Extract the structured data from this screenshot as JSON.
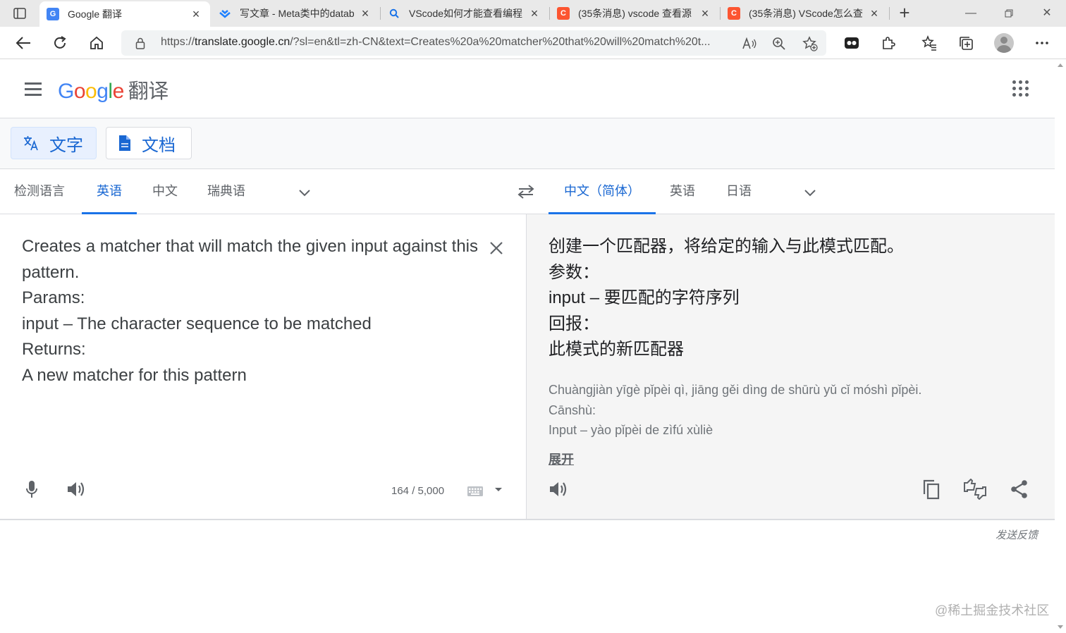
{
  "browser": {
    "tabs": [
      {
        "title": "Google 翻译",
        "favicon": "google-translate-icon",
        "active": true
      },
      {
        "title": "写文章 - Meta类中的datab",
        "favicon": "juejin-icon",
        "active": false
      },
      {
        "title": "VScode如何才能查看编程",
        "favicon": "search-icon",
        "active": false
      },
      {
        "title": "(35条消息) vscode 查看源",
        "favicon": "csdn-icon",
        "active": false
      },
      {
        "title": "(35条消息) VScode怎么查",
        "favicon": "csdn-icon",
        "active": false
      }
    ],
    "url_prefix": "https://",
    "url_domain": "translate.google.cn",
    "url_rest": "/?sl=en&tl=zh-CN&text=Creates%20a%20matcher%20that%20will%20match%20t..."
  },
  "header": {
    "product": "翻译",
    "logo_letters": [
      "G",
      "o",
      "o",
      "g",
      "l",
      "e"
    ]
  },
  "modes": {
    "text_label": "文字",
    "doc_label": "文档"
  },
  "source_langs": [
    "检测语言",
    "英语",
    "中文",
    "瑞典语"
  ],
  "target_langs": [
    "中文（简体）",
    "英语",
    "日语"
  ],
  "source": {
    "lines": [
      "Creates a matcher that will match the given input against this",
      "pattern.",
      "Params:",
      "input – The character sequence to be matched",
      "Returns:",
      "A new matcher for this pattern"
    ],
    "counter": "164 / 5,000"
  },
  "target": {
    "lines": [
      "创建一个匹配器，将给定的输入与此模式匹配。",
      "参数：",
      "input – 要匹配的字符序列",
      "回报：",
      "此模式的新匹配器"
    ],
    "pinyin": [
      "Chuàngjiàn yīgè pǐpèi qì, jiāng gěi dìng de shūrù yǔ cǐ móshì pǐpèi.",
      "Cānshù:",
      "Input – yào pǐpèi de zìfú xùliè"
    ],
    "expand_label": "展开"
  },
  "footer": {
    "feedback": "发送反馈",
    "watermark": "@稀土掘金技术社区"
  },
  "colors": {
    "accent": "#1a73e8",
    "csdn": "#fc5531",
    "target_bg": "#f5f5f5"
  }
}
